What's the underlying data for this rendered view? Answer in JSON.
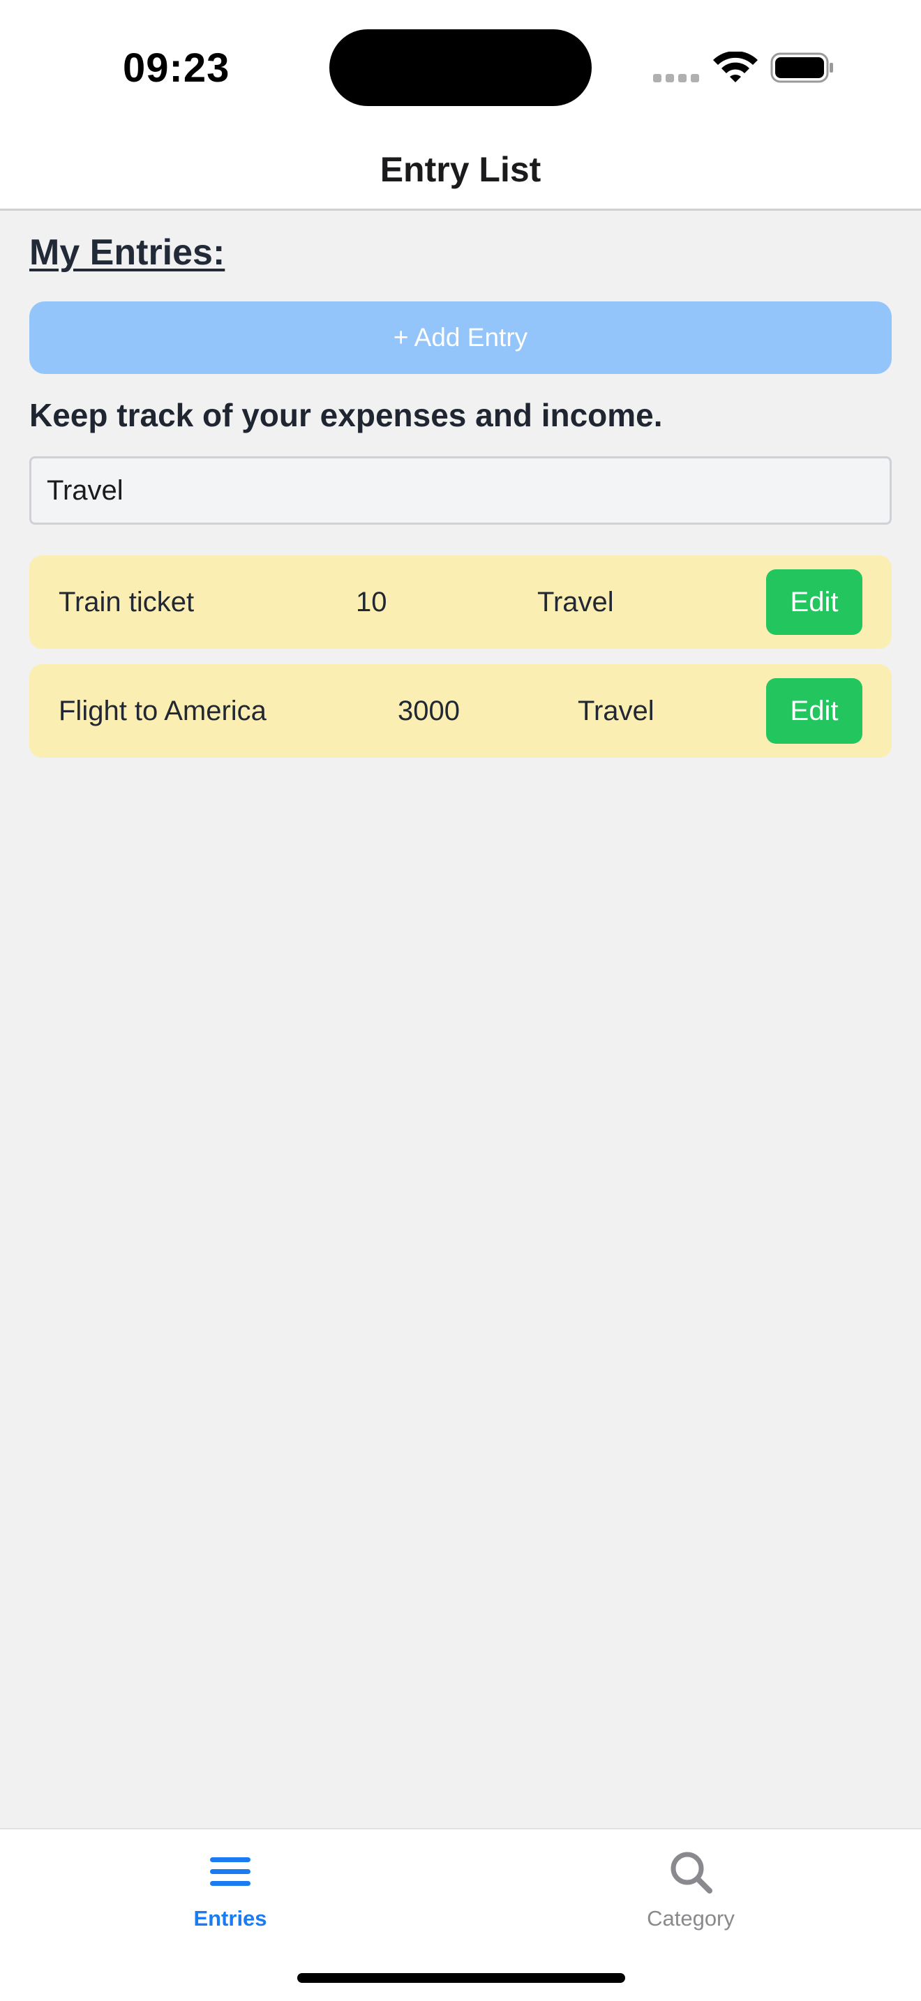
{
  "status_bar": {
    "time": "09:23"
  },
  "header": {
    "title": "Entry List"
  },
  "main": {
    "section_title": "My Entries:",
    "add_button_label": "+ Add Entry",
    "tagline": "Keep track of your expenses and income.",
    "filter_value": "Travel",
    "entries": [
      {
        "name": "Train ticket",
        "amount": "10",
        "category": "Travel",
        "edit_label": "Edit"
      },
      {
        "name": "Flight to America",
        "amount": "3000",
        "category": "Travel",
        "edit_label": "Edit"
      }
    ]
  },
  "tab_bar": {
    "tabs": [
      {
        "label": "Entries",
        "icon": "list-icon",
        "active": true
      },
      {
        "label": "Category",
        "icon": "search-icon",
        "active": false
      }
    ]
  },
  "colors": {
    "add_button": "#93c5fa",
    "entry_row": "#fbeeb3",
    "edit_button": "#22c55e",
    "active_tab": "#1a7cf0"
  }
}
